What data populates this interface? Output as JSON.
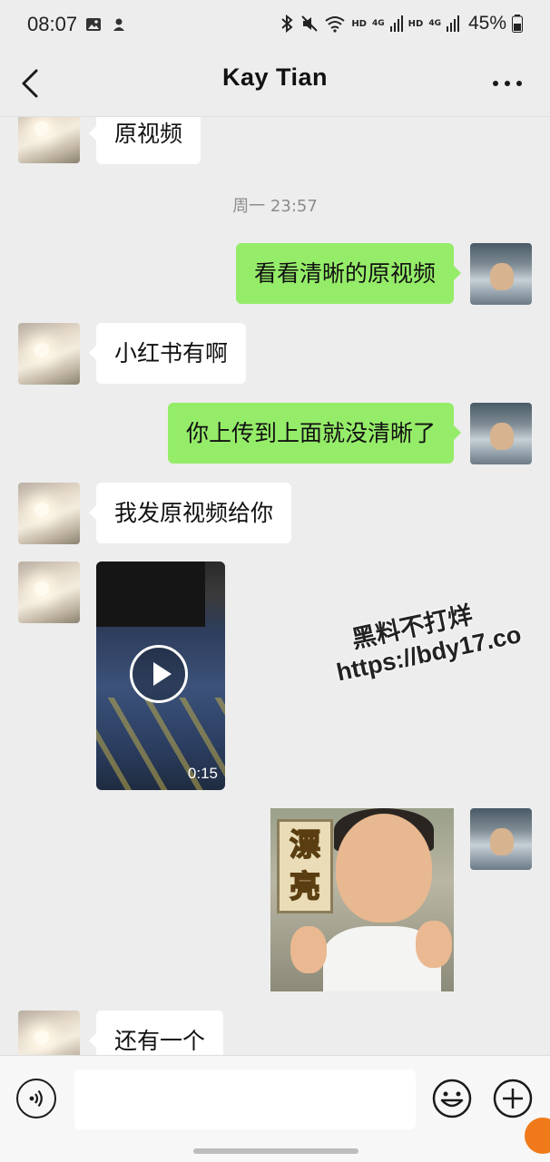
{
  "status_bar": {
    "time": "08:07",
    "hd1": "HD",
    "net1": "4G",
    "hd2": "HD",
    "net2": "4G",
    "battery": "45%"
  },
  "header": {
    "title": "Kay  Tian",
    "back_icon": "chevron-left-icon",
    "more_icon": "more-horizontal-icon"
  },
  "messages": [
    {
      "from": "contact",
      "type": "text",
      "text": "原视频"
    },
    {
      "type": "time",
      "text": "周一 23:57"
    },
    {
      "from": "me",
      "type": "text",
      "text": "看看清晰的原视频"
    },
    {
      "from": "contact",
      "type": "text",
      "text": "小红书有啊"
    },
    {
      "from": "me",
      "type": "text",
      "text": "你上传到上面就没清晰了"
    },
    {
      "from": "contact",
      "type": "text",
      "text": "我发原视频给你"
    },
    {
      "from": "contact",
      "type": "video",
      "duration": "0:15"
    },
    {
      "from": "me",
      "type": "sticker",
      "sticker_text": [
        "漂",
        "亮"
      ]
    },
    {
      "from": "contact",
      "type": "text",
      "text": "还有一个"
    }
  ],
  "watermark": {
    "line1": "黑料不打烊",
    "line2": "https://bdy17.co"
  },
  "input_bar": {
    "placeholder": "",
    "voice_icon": "voice-icon",
    "emoji_icon": "emoji-icon",
    "plus_icon": "plus-circle-icon"
  },
  "colors": {
    "background": "#ededed",
    "outgoing_bubble": "#95ec69",
    "incoming_bubble": "#ffffff"
  }
}
